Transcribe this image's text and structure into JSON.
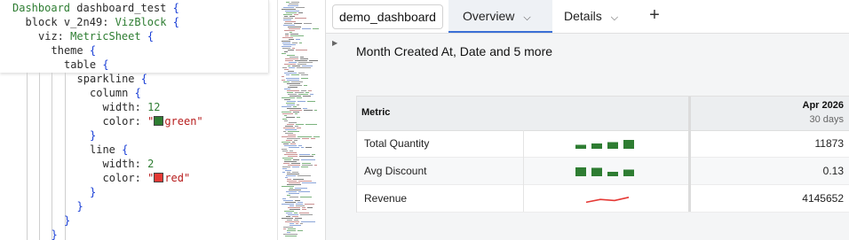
{
  "editor": {
    "lines": [
      {
        "indent": 0,
        "parts": [
          [
            "kw",
            "Dashboard "
          ],
          [
            "id",
            "dashboard_test "
          ],
          [
            "br",
            "{"
          ]
        ]
      },
      {
        "indent": 1,
        "parts": [
          [
            "id",
            "block v_2n49: "
          ],
          [
            "kw",
            "VizBlock "
          ],
          [
            "br",
            "{"
          ]
        ]
      },
      {
        "indent": 2,
        "parts": [
          [
            "id",
            "viz: "
          ],
          [
            "kw",
            "MetricSheet "
          ],
          [
            "br",
            "{"
          ]
        ]
      },
      {
        "indent": 3,
        "parts": [
          [
            "id",
            "theme "
          ],
          [
            "br",
            "{"
          ]
        ]
      },
      {
        "indent": 4,
        "parts": [
          [
            "id",
            "table "
          ],
          [
            "br",
            "{"
          ]
        ]
      },
      {
        "indent": 5,
        "parts": [
          [
            "id",
            "sparkline "
          ],
          [
            "br",
            "{"
          ]
        ]
      },
      {
        "indent": 6,
        "parts": [
          [
            "id",
            "column "
          ],
          [
            "br",
            "{"
          ]
        ]
      },
      {
        "indent": 7,
        "parts": [
          [
            "id",
            "width: "
          ],
          [
            "num",
            "12"
          ]
        ]
      },
      {
        "indent": 7,
        "parts": [
          [
            "id",
            "color: "
          ],
          [
            "str",
            "\""
          ],
          [
            "swatch",
            "#2e7d32"
          ],
          [
            "str",
            "green\""
          ]
        ]
      },
      {
        "indent": 6,
        "parts": [
          [
            "br",
            "}"
          ]
        ]
      },
      {
        "indent": 6,
        "parts": [
          [
            "id",
            "line "
          ],
          [
            "br",
            "{"
          ]
        ]
      },
      {
        "indent": 7,
        "parts": [
          [
            "id",
            "width: "
          ],
          [
            "num",
            "2"
          ]
        ]
      },
      {
        "indent": 7,
        "parts": [
          [
            "id",
            "color: "
          ],
          [
            "str",
            "\""
          ],
          [
            "swatch",
            "#e53935"
          ],
          [
            "str",
            "red\""
          ]
        ]
      },
      {
        "indent": 6,
        "parts": [
          [
            "br",
            "}"
          ]
        ]
      },
      {
        "indent": 5,
        "parts": [
          [
            "br",
            "}"
          ]
        ]
      },
      {
        "indent": 4,
        "parts": [
          [
            "br",
            "}"
          ]
        ]
      },
      {
        "indent": 3,
        "parts": [
          [
            "br",
            "}"
          ]
        ]
      }
    ]
  },
  "tabs": {
    "dashboard_name": "demo_dashboard",
    "overview": "Overview",
    "details": "Details",
    "chevron": "⌵",
    "add": "+"
  },
  "viz": {
    "title": "Month Created At, Date and 5 more",
    "header_metric": "Metric",
    "header_date": "Apr 2026",
    "header_sub": "30 days",
    "rows": [
      {
        "name": "Total Quantity",
        "value": "11873",
        "spark_type": "column",
        "spark": [
          0.45,
          0.6,
          0.75,
          1.0
        ]
      },
      {
        "name": "Avg Discount",
        "value": "0.13",
        "spark_type": "column",
        "spark": [
          1.0,
          0.95,
          0.5,
          0.75
        ]
      },
      {
        "name": "Revenue",
        "value": "4145652",
        "spark_type": "line",
        "spark": [
          0.2,
          0.6,
          0.45,
          0.9
        ]
      }
    ]
  },
  "colors": {
    "column": "#2e7d32",
    "line": "#e53935",
    "accent": "#3b6fd6"
  }
}
